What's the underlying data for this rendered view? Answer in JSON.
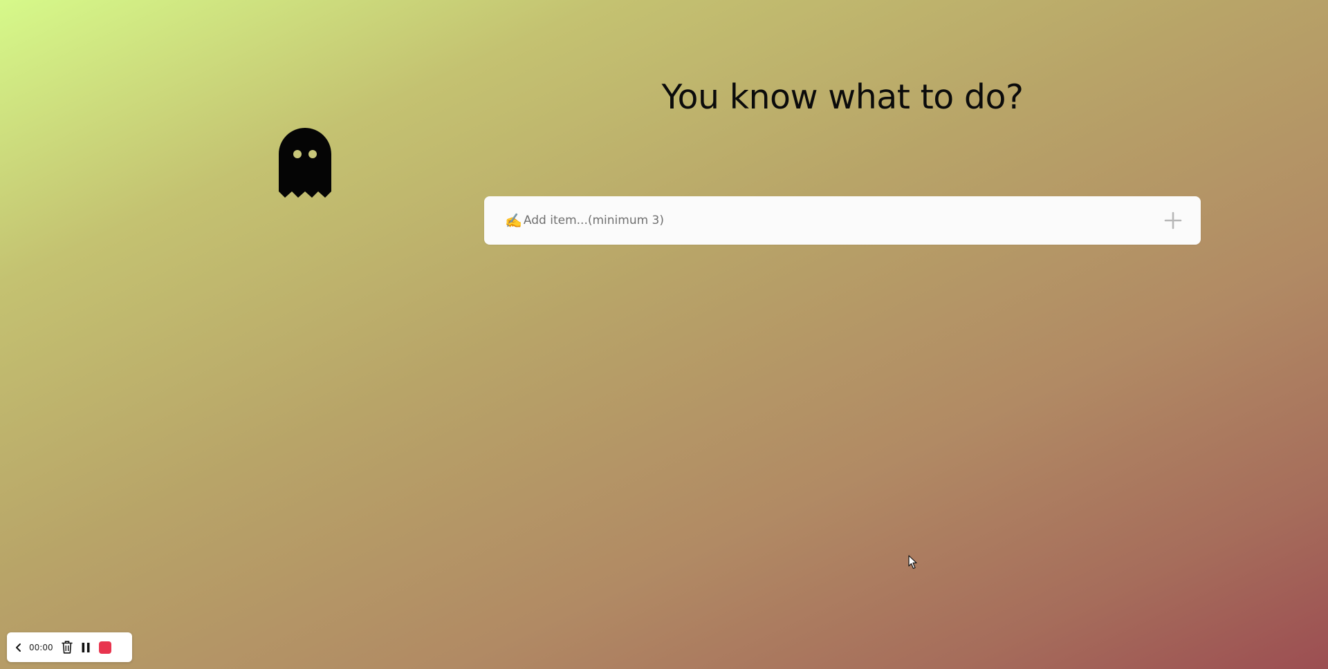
{
  "heading": "You know what to do?",
  "add_form": {
    "emoji": "✍️",
    "placeholder": "Add item...(minimum 3)",
    "value": ""
  },
  "recorder": {
    "timer": "00:00",
    "stop_color": "#e8344e"
  },
  "icons": {
    "logo": "ghost-icon",
    "add": "plus-icon",
    "back": "chevron-left-icon",
    "delete": "trash-icon",
    "pause": "pause-icon",
    "stop": "stop-icon",
    "cursor": "mouse-pointer-icon"
  },
  "colors": {
    "gradient_start": "#d6f98a",
    "gradient_end": "#9c4e52",
    "text": "#0b0b0b",
    "input_bg": "#fbfbfb"
  }
}
